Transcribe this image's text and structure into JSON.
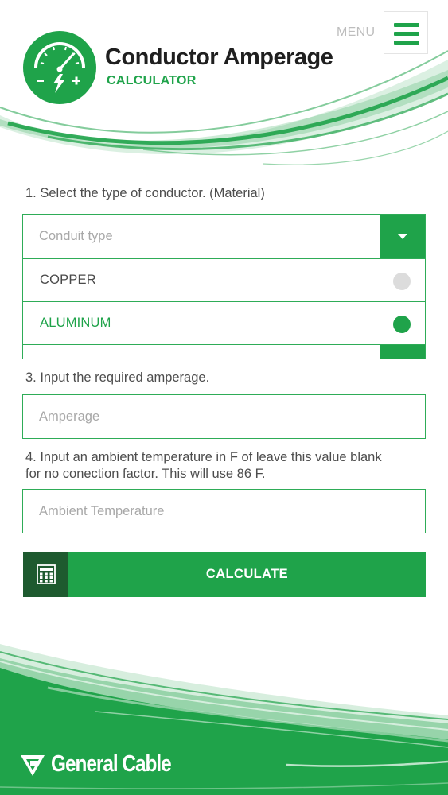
{
  "header": {
    "title": "Conductor Amperage",
    "subtitle": "CALCULATOR",
    "menu_label": "MENU",
    "menu_icon": "hamburger-icon",
    "logo_icon": "amperage-gauge-icon"
  },
  "form": {
    "step1_label": "1.  Select the type of conductor. (Material)",
    "conduit_select": {
      "placeholder": "Conduit type",
      "icon": "chevron-down-icon"
    },
    "conductor_options": [
      {
        "label": "COPPER",
        "selected": false
      },
      {
        "label": "ALUMINUM",
        "selected": true
      }
    ],
    "step3_label": "3. Input the required amperage.",
    "amperage_placeholder": "Amperage",
    "step4_label_line1": "4. Input an ambient temperature in F of leave this value blank",
    "step4_label_line2": "for no conection factor.  This will use 86 F.",
    "temperature_placeholder": "Ambient Temperature",
    "calculate_label": "CALCULATE",
    "calculate_icon": "calculator-icon"
  },
  "footer": {
    "brand_name": "General Cable",
    "brand_icon": "general-cable-logo-icon"
  },
  "colors": {
    "accent": "#1fa34a",
    "accent_dark": "#1e5a2f",
    "border": "#2eac57",
    "radio_off": "#dcdcdc",
    "text": "#4d4d4d",
    "placeholder": "#a8a8a8"
  }
}
